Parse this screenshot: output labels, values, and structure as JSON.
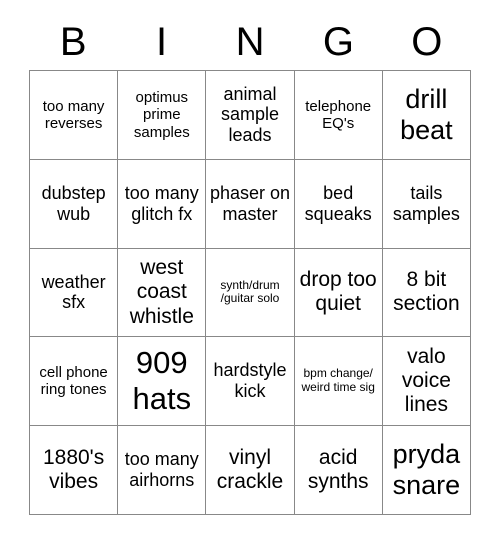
{
  "card": {
    "headers": [
      "B",
      "I",
      "N",
      "G",
      "O"
    ],
    "rows": [
      [
        {
          "text": "too many reverses",
          "size": "sm"
        },
        {
          "text": "optimus prime samples",
          "size": "sm"
        },
        {
          "text": "animal sample leads",
          "size": "md"
        },
        {
          "text": "telephone EQ's",
          "size": "sm"
        },
        {
          "text": "drill beat",
          "size": "xl"
        }
      ],
      [
        {
          "text": "dubstep wub",
          "size": "md"
        },
        {
          "text": "too many glitch fx",
          "size": "md"
        },
        {
          "text": "phaser on master",
          "size": "md"
        },
        {
          "text": "bed squeaks",
          "size": "md"
        },
        {
          "text": "tails samples",
          "size": "md"
        }
      ],
      [
        {
          "text": "weather sfx",
          "size": "md"
        },
        {
          "text": "west coast whistle",
          "size": "lg"
        },
        {
          "text": "synth/drum /guitar solo",
          "size": "xs"
        },
        {
          "text": "drop too quiet",
          "size": "lg"
        },
        {
          "text": "8 bit section",
          "size": "lg"
        }
      ],
      [
        {
          "text": "cell phone ring tones",
          "size": "sm"
        },
        {
          "text": "909 hats",
          "size": "xxl"
        },
        {
          "text": "hardstyle kick",
          "size": "md"
        },
        {
          "text": "bpm change/ weird time sig",
          "size": "xs"
        },
        {
          "text": "valo voice lines",
          "size": "lg"
        }
      ],
      [
        {
          "text": "1880's vibes",
          "size": "lg"
        },
        {
          "text": "too many airhorns",
          "size": "md"
        },
        {
          "text": "vinyl crackle",
          "size": "lg"
        },
        {
          "text": "acid synths",
          "size": "lg"
        },
        {
          "text": "pryda snare",
          "size": "xl"
        }
      ]
    ]
  }
}
